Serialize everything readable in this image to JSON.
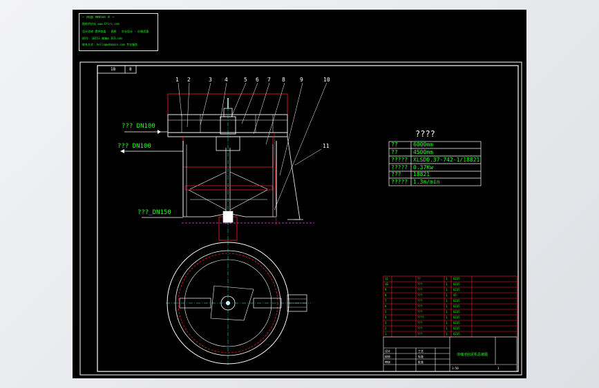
{
  "stamp": {
    "line1": "— 凤凰 NdEas e —",
    "line2": "图纸供应站  www.Gfs/s.com",
    "line3": "设计咨询 提供各类 · 图纸 · 毕业设计 · 价格优惠",
    "line4": "QQ号: 10153 邮箱@ 163.com",
    "line5": "联系方式: hello@wdomain.com 专业服务"
  },
  "frame": {
    "corner_a": "18",
    "corner_b": "8"
  },
  "callouts": [
    "1",
    "2",
    "3",
    "4",
    "5",
    "6",
    "7",
    "8",
    "9",
    "10",
    "11"
  ],
  "pipes": {
    "inlet": "??? DN100",
    "outlet": "??? DN100",
    "drain": "???_DN150"
  },
  "spec": {
    "title": "????",
    "rows": [
      [
        "??",
        "6000mm"
      ],
      [
        "??",
        "4500mm"
      ],
      [
        "?????",
        "XLSD0.37-742-1/18821"
      ],
      [
        "?????",
        "0.37Kw"
      ],
      [
        "???",
        "18821"
      ],
      [
        "?????",
        "1.3m/min"
      ]
    ]
  },
  "bom": {
    "rows": [
      [
        "11",
        "",
        "??",
        "1",
        "Q235"
      ],
      [
        "10",
        "",
        "???",
        "1",
        "Q235"
      ],
      [
        "9",
        "",
        "???",
        "1",
        "Q235"
      ],
      [
        "8",
        "",
        "???",
        "1",
        "45"
      ],
      [
        "7",
        "",
        "???",
        "1",
        "Q235"
      ],
      [
        "6",
        "",
        "???",
        "1",
        "Q235"
      ],
      [
        "5",
        "",
        "???",
        "1",
        "Q235"
      ],
      [
        "4",
        "",
        "????",
        "1",
        "Q235"
      ],
      [
        "3",
        "",
        "???",
        "1",
        "Q235"
      ],
      [
        "2",
        "",
        "???",
        "1",
        "Q235"
      ],
      [
        "1",
        "",
        "???",
        "1",
        "Q235"
      ]
    ]
  },
  "title_block": {
    "drawing_title": "浓缩池刮泥机总装图",
    "scale": "1:50",
    "sheet": "1",
    "labels": [
      "设计",
      "校核",
      "审核",
      "工艺",
      "标准",
      "批准"
    ],
    "dates": [
      "",
      "",
      "",
      "",
      "",
      ""
    ]
  },
  "colors": {
    "green": "#22ff22",
    "white": "#ffffff",
    "cyan": "#00ffff",
    "red": "#ff2020",
    "magenta": "#ff40ff",
    "yellow": "#ffff00"
  }
}
